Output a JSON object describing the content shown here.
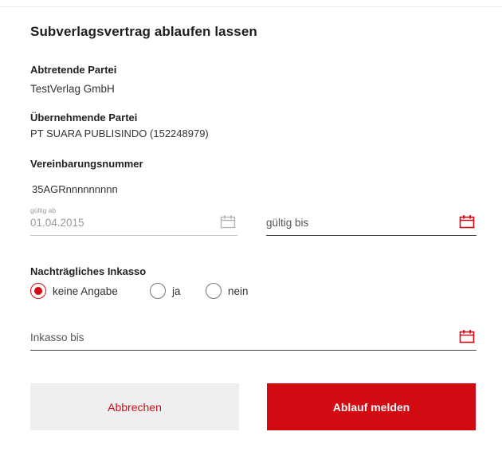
{
  "dialog": {
    "title": "Subverlagsvertrag ablaufen lassen",
    "assigning_party": {
      "label": "Abtretende Partei",
      "value": "TestVerlag GmbH"
    },
    "receiving_party": {
      "label": "Übernehmende Partei",
      "value": "PT SUARA PUBLISINDO (152248979)"
    },
    "agreement_number": {
      "label": "Vereinbarungsnummer",
      "value": "35AGRnnnnnnnnn"
    },
    "valid_from": {
      "small_label": "gültig ab",
      "value": "01.04.2015",
      "icon": "calendar-icon"
    },
    "valid_until": {
      "placeholder": "gültig bis",
      "icon": "calendar-icon"
    },
    "collection": {
      "label": "Nachträgliches Inkasso",
      "options": [
        "keine Angabe",
        "ja",
        "nein"
      ],
      "selected": "keine Angabe"
    },
    "collection_until": {
      "placeholder": "Inkasso bis",
      "icon": "calendar-icon"
    },
    "buttons": {
      "cancel": "Abbrechen",
      "submit": "Ablauf melden"
    }
  },
  "colors": {
    "accent": "#d20a11",
    "disabled_text": "#9a9a9a",
    "cancel_bg": "#efefef"
  }
}
